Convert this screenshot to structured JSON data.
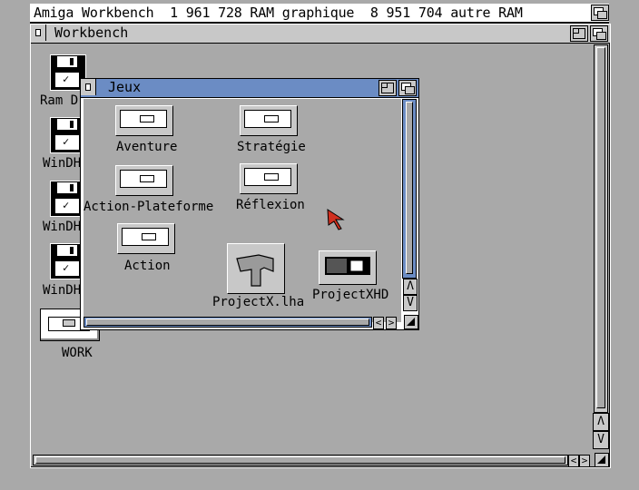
{
  "screen": {
    "title": "Amiga Workbench  1 961 728 RAM graphique  8 951 704 autre RAM"
  },
  "workbench_window": {
    "title": "Workbench",
    "icons": [
      {
        "label": "Ram D",
        "type": "disk"
      },
      {
        "label": "WinDH",
        "type": "disk"
      },
      {
        "label": "WinDH",
        "type": "disk"
      },
      {
        "label": "WinDH",
        "type": "disk"
      },
      {
        "label": "WORK",
        "type": "drawer-disk"
      }
    ],
    "arrow_up": "Λ",
    "arrow_down": "V",
    "arrow_left": "<",
    "arrow_right": ">"
  },
  "jeux_window": {
    "title": "Jeux",
    "drawers": [
      {
        "label": "Aventure"
      },
      {
        "label": "Stratégie"
      },
      {
        "label": "Action-Plateforme"
      },
      {
        "label": "Réflexion"
      },
      {
        "label": "Action"
      }
    ],
    "tools": [
      {
        "label": "ProjectX.lha",
        "icon": "hammer-icon"
      },
      {
        "label": "ProjectXHD",
        "icon": "project-icon"
      }
    ],
    "arrow_up": "Λ",
    "arrow_down": "V",
    "arrow_left": "<",
    "arrow_right": ">"
  },
  "colors": {
    "desktop": "#a9a9a9",
    "active_title": "#6b8cc4",
    "pointer": "#d03020"
  }
}
